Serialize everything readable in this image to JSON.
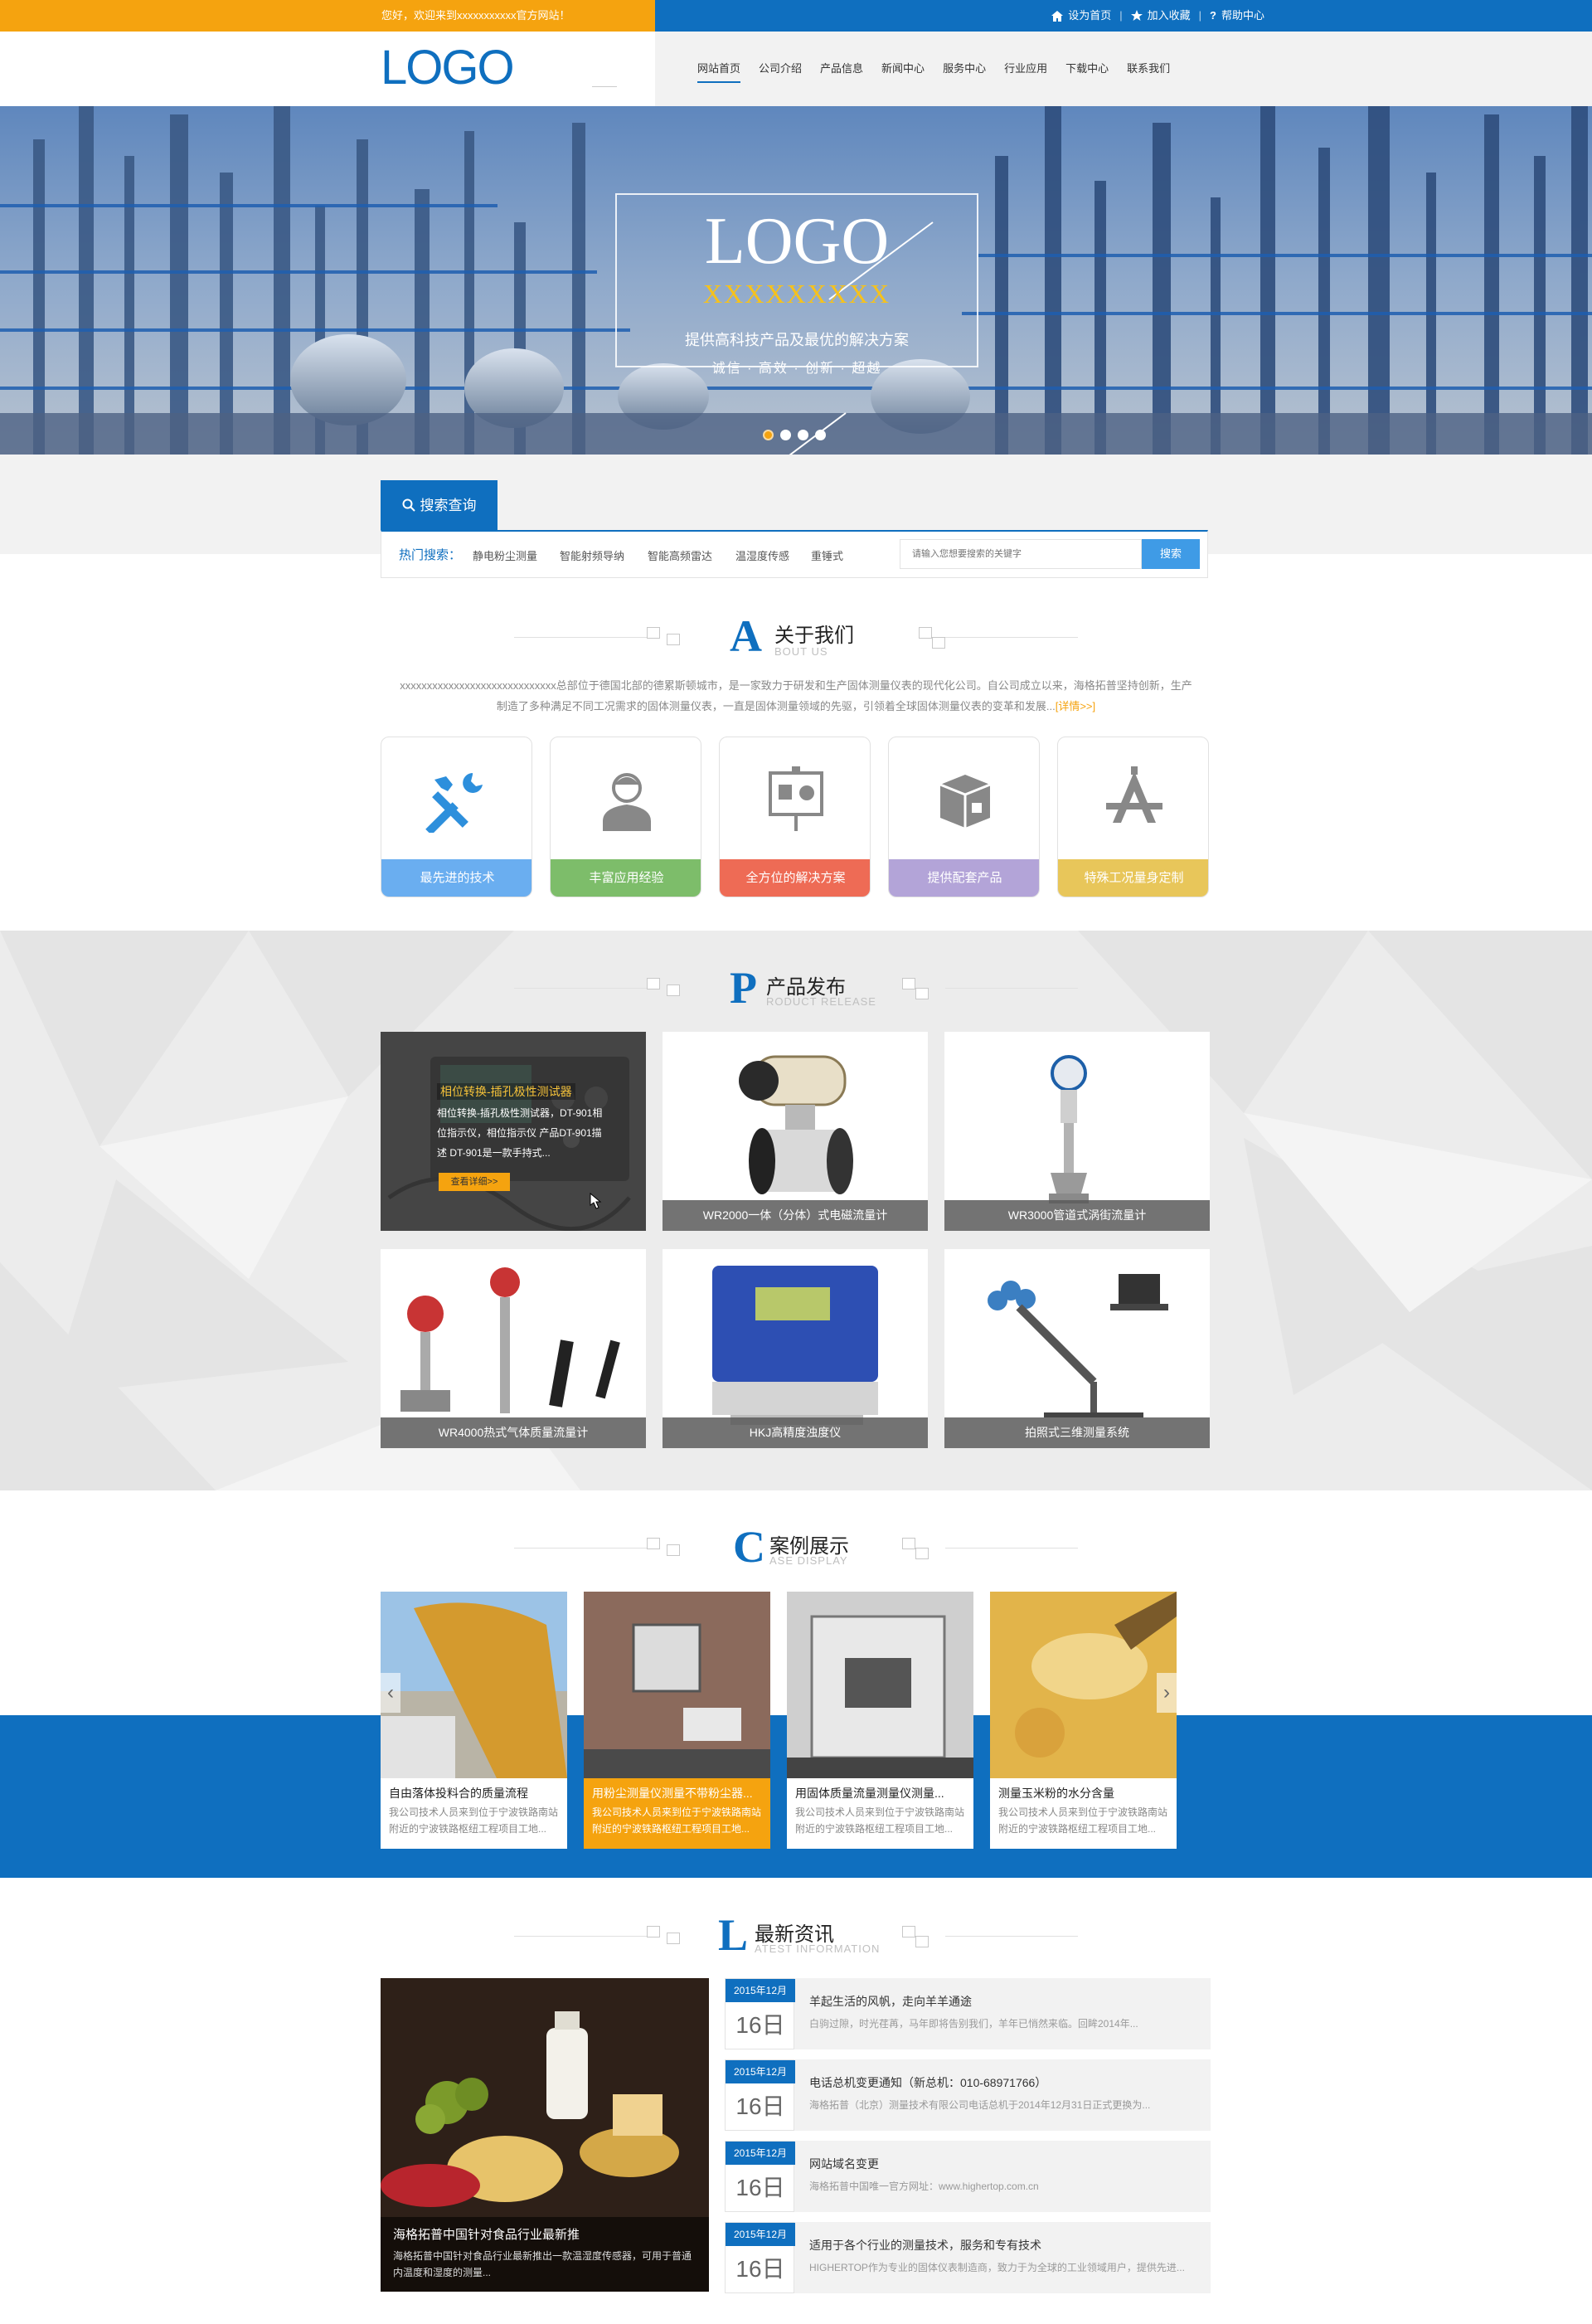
{
  "topbar": {
    "welcome": "您好，欢迎来到xxxxxxxxxxx官方网站！",
    "links": [
      {
        "icon": "home-icon",
        "label": "设为首页"
      },
      {
        "icon": "star-icon",
        "label": "加入收藏"
      },
      {
        "icon": "question-icon",
        "label": "帮助中心"
      }
    ]
  },
  "header": {
    "logo": "LOGO",
    "nav": [
      "网站首页",
      "公司介绍",
      "产品信息",
      "新闻中心",
      "服务中心",
      "行业应用",
      "下载中心",
      "联系我们"
    ]
  },
  "banner": {
    "logo": "LOGO",
    "placeholder": "XXXXXXXXX",
    "slogan": "提供高科技产品及最优的解决方案",
    "motto": "诚信 · 高效 · 创新 · 超越",
    "slides": 4,
    "active_slide": 1
  },
  "search": {
    "tab_label": "搜索查询",
    "hot_label": "热门搜索：",
    "hot_items": [
      "静电粉尘测量",
      "智能射频导纳",
      "智能高频雷达",
      "温湿度传感",
      "重锤式"
    ],
    "placeholder": "请输入您想要搜索的关键字",
    "button": "搜索"
  },
  "about": {
    "letter": "A",
    "title": "关于我们",
    "subtitle": "BOUT US",
    "text": "xxxxxxxxxxxxxxxxxxxxxxxxxxxxx总部位于德国北部的德累斯顿城市，是一家致力于研发和生产固体测量仪表的现代化公司。自公司成立以来，海格拓普坚持创新，生产制造了多种满足不同工况需求的固体测量仪表，一直是固体测量领域的先驱，引领着全球固体测量仪表的变革和发展...",
    "more": "[详情>>]",
    "cards": [
      {
        "icon": "tools-icon",
        "label": "最先进的技术",
        "color": "#6aaef0"
      },
      {
        "icon": "user-icon",
        "label": "丰富应用经验",
        "color": "#7dbd6a"
      },
      {
        "icon": "presentation-icon",
        "label": "全方位的解决方案",
        "color": "#ee6b55"
      },
      {
        "icon": "box-icon",
        "label": "提供配套产品",
        "color": "#b3a4d8"
      },
      {
        "icon": "compass-icon",
        "label": "特殊工况量身定制",
        "color": "#e8c65a"
      }
    ]
  },
  "products": {
    "letter": "P",
    "title": "产品发布",
    "subtitle": "RODUCT RELEASE",
    "featured": {
      "title": "相位转换-插孔极性测试器",
      "desc": "相位转换-插孔极性测试器，DT-901相位指示仪，相位指示仪 产品DT-901描述 DT-901是一款手持式...",
      "button": "查看详细>>"
    },
    "items": [
      {
        "label": "相位转换-插孔极性测试器"
      },
      {
        "label": "WR2000一体（分体）式电磁流量计"
      },
      {
        "label": "WR3000管道式涡街流量计"
      },
      {
        "label": "WR4000热式气体质量流量计"
      },
      {
        "label": "HKJ高精度浊度仪"
      },
      {
        "label": "拍照式三维测量系统"
      }
    ]
  },
  "cases": {
    "letter": "C",
    "title": "案例展示",
    "subtitle": "ASE DISPLAY",
    "items": [
      {
        "title": "自由落体投料合的质量流程",
        "desc": "我公司技术人员来到位于宁波铁路南站附近的宁波铁路枢纽工程项目工地..."
      },
      {
        "title": "用粉尘测量仪测量不带粉尘器...",
        "desc": "我公司技术人员来到位于宁波铁路南站附近的宁波铁路枢纽工程项目工地..."
      },
      {
        "title": "用固体质量流量测量仪测量...",
        "desc": "我公司技术人员来到位于宁波铁路南站附近的宁波铁路枢纽工程项目工地..."
      },
      {
        "title": "测量玉米粉的水分含量",
        "desc": "我公司技术人员来到位于宁波铁路南站附近的宁波铁路枢纽工程项目工地..."
      }
    ]
  },
  "news": {
    "letter": "L",
    "title": "最新资讯",
    "subtitle": "ATEST INFORMATION",
    "main": {
      "title": "海格拓普中国针对食品行业最新推",
      "desc": "海格拓普中国针对食品行业最新推出一款温湿度传感器，可用于普通内温度和湿度的测量..."
    },
    "items": [
      {
        "ym": "2015年12月",
        "day": "16日",
        "title": "羊起生活的风帆，走向羊羊通途",
        "desc": "白驹过隙，时光荏苒，马年即将告别我们，羊年已悄然来临。回眸2014年..."
      },
      {
        "ym": "2015年12月",
        "day": "16日",
        "title": "电话总机变更通知（新总机：010-68971766）",
        "desc": "海格拓普（北京）测量技术有限公司电话总机于2014年12月31日正式更换为..."
      },
      {
        "ym": "2015年12月",
        "day": "16日",
        "title": "网站域名变更",
        "desc": "海格拓普中国唯一官方网址：www.highertop.com.cn"
      },
      {
        "ym": "2015年12月",
        "day": "16日",
        "title": "适用于各个行业的测量技术，服务和专有技术",
        "desc": "HIGHERTOP作为专业的固体仪表制造商，致力于为全球的工业领域用户，提供先进..."
      }
    ]
  }
}
